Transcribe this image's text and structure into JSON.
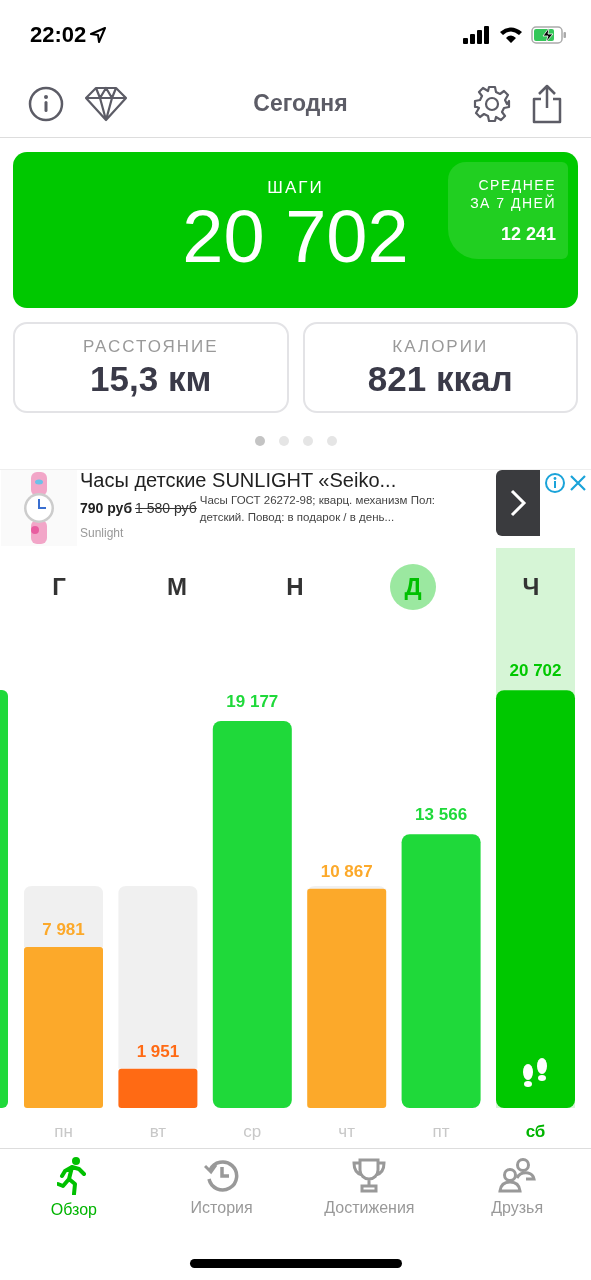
{
  "status_bar": {
    "time": "22:02"
  },
  "nav": {
    "title": "Сегодня"
  },
  "steps_card": {
    "label": "ШАГИ",
    "value": "20 702",
    "average_label": "СРЕДНЕЕ ЗА 7 ДНЕЙ",
    "average_value": "12 241"
  },
  "stat_cards": [
    {
      "label": "РАССТОЯНИЕ",
      "value": "15,3 км"
    },
    {
      "label": "КАЛОРИИ",
      "value": "821 ккал"
    }
  ],
  "page_dots": [
    {
      "selected": true
    },
    {
      "selected": false
    },
    {
      "selected": false
    },
    {
      "selected": false
    }
  ],
  "ad": {
    "title": "Часы детские SUNLIGHT «Seiko...",
    "price": "790 руб",
    "old_price": "1 580 руб",
    "description": "Часы ГОСТ 26272-98; кварц. механизм Пол: детский. Повод: в подарок / в день...",
    "advertiser": "Sunlight"
  },
  "letters": [
    {
      "text": "Г",
      "selected": false
    },
    {
      "text": "М",
      "selected": false
    },
    {
      "text": "Н",
      "selected": false
    },
    {
      "text": "Д",
      "selected": true
    },
    {
      "text": "Ч",
      "selected": false
    }
  ],
  "chart": {
    "bars": [
      {
        "selected": false
      },
      {
        "selected": false
      },
      {
        "selected": false
      },
      {
        "selected": false
      },
      {
        "selected": false
      },
      {
        "selected": true
      }
    ],
    "chart_data": {
      "type": "bar",
      "categories": [
        "пн",
        "вт",
        "ср",
        "чт",
        "пт",
        "сб"
      ],
      "stacked": true,
      "data_labels": true,
      "series": [
        {
          "color": "#fca92a",
          "values": [
            7981,
            null,
            null,
            10867,
            null,
            null
          ]
        },
        {
          "color": "#ff6a14",
          "values": [
            null,
            1951,
            null,
            null,
            null,
            null
          ]
        },
        {
          "color": "#1fd93a",
          "values": [
            null,
            null,
            19177,
            null,
            13566,
            null
          ]
        },
        {
          "color": "#00c800",
          "values": [
            null,
            null,
            null,
            null,
            null,
            20702
          ]
        }
      ]
    }
  },
  "tabs": [
    {
      "label": "Обзор",
      "kind": "runner",
      "selected": true
    },
    {
      "label": "История",
      "kind": "history",
      "selected": false
    },
    {
      "label": "Достижения",
      "kind": "trophy",
      "selected": false
    },
    {
      "label": "Друзья",
      "kind": "friends",
      "selected": false
    }
  ]
}
